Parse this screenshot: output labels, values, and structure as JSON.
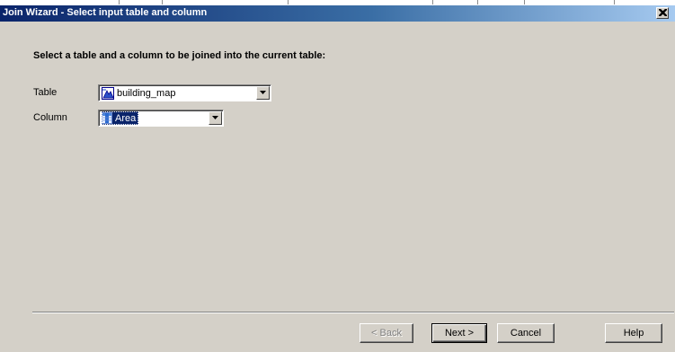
{
  "window": {
    "title": "Join Wizard - Select input table and column",
    "close_icon": "close-icon"
  },
  "main": {
    "heading": "Select a table and a column to be joined into the current table:",
    "table": {
      "label": "Table",
      "value": "building_map",
      "icon": "map-table-icon"
    },
    "column": {
      "label": "Column",
      "value": "Area",
      "icon": "column-icon"
    }
  },
  "buttons": {
    "back": "< Back",
    "next": "Next >",
    "cancel": "Cancel",
    "help": "Help"
  },
  "colors": {
    "title_gradient_start": "#0a246a",
    "title_gradient_end": "#a6caf0",
    "dialog_face": "#d4d0c8",
    "selection": "#0a246a"
  }
}
